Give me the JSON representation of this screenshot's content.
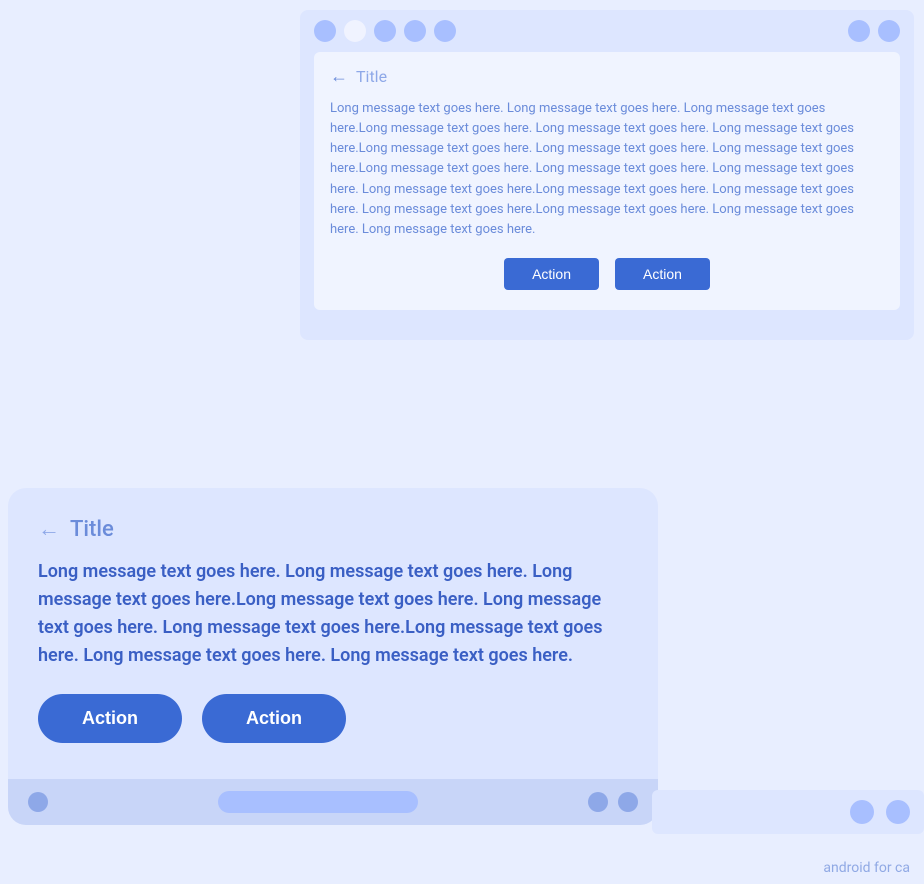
{
  "top_mockup": {
    "status_dots": [
      "dot",
      "dot-active",
      "dot",
      "dot",
      "dot"
    ],
    "title": "Title",
    "message": "Long message text goes here. Long message text goes here. Long message text goes here.Long message text goes here. Long message text goes here. Long message text goes here.Long message text goes here. Long message text goes here. Long message text goes here.Long message text goes here. Long message text goes here. Long message text goes here. Long message text goes here.Long message text goes here. Long message text goes here. Long message text goes here.Long message text goes here. Long message text goes here. Long message text goes here.",
    "button1": "Action",
    "button2": "Action"
  },
  "bottom_mockup": {
    "title": "Title",
    "message": "Long message text goes here. Long message text goes here. Long message text goes here.Long message text goes here. Long message text goes here. Long message text goes here.Long message text goes here. Long message text goes here. Long message text goes here.",
    "button1": "Action",
    "button2": "Action"
  },
  "watermark": "android for ca"
}
